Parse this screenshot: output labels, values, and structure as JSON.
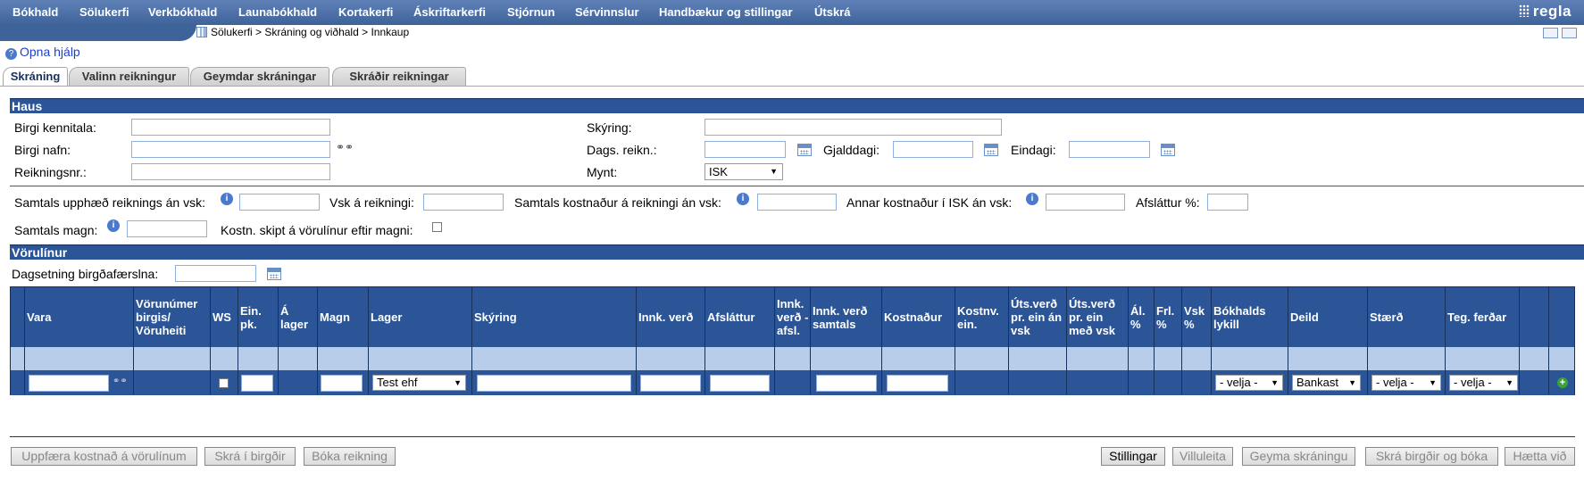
{
  "nav": {
    "items": [
      "Bókhald",
      "Sölukerfi",
      "Verkbókhald",
      "Launabókhald",
      "Kortakerfi",
      "Áskriftarkerfi",
      "Stjórnun",
      "Sérvinnslur",
      "Handbækur og stillingar",
      "Útskrá"
    ],
    "logo": "regla"
  },
  "breadcrumb": "Sölukerfi > Skráning og viðhald > Innkaup",
  "help": "Opna hjálp",
  "tabs": [
    "Skráning",
    "Valinn reikningur",
    "Geymdar skráningar",
    "Skráðir reikningar"
  ],
  "haus": {
    "title": "Haus",
    "birgi_kennitala": "Birgi kennitala:",
    "birgi_nafn": "Birgi nafn:",
    "reikningsnr": "Reikningsnr.:",
    "skyring": "Skýring:",
    "dags_reikn": "Dags. reikn.:",
    "gjalddagi": "Gjalddagi:",
    "eindagi": "Eindagi:",
    "mynt": "Mynt:",
    "mynt_value": "ISK"
  },
  "totals": {
    "samtals_upphaed": "Samtals upphæð reiknings án vsk:",
    "vsk": "Vsk á reikningi:",
    "samtals_kostnadur": "Samtals kostnaður á reikningi án vsk:",
    "annar_kostnadur": "Annar kostnaður í ISK án vsk:",
    "afslattur": "Afsláttur %:",
    "samtals_magn": "Samtals magn:",
    "kostn_skipt": "Kostn. skipt á vörulínur eftir magni:"
  },
  "vorulinur": {
    "title": "Vörulínur",
    "dagsetning": "Dagsetning birgðafærslna:",
    "headers": [
      "Vara",
      "Vörunúmer birgis/ Vöruheiti",
      "WS",
      "Ein. pk.",
      "Á lager",
      "Magn",
      "Lager",
      "Skýring",
      "Innk. verð",
      "Afsláttur",
      "Innk. verð - afsl.",
      "Innk. verð samtals",
      "Kostnaður",
      "Kostnv. ein.",
      "Úts.verð pr. ein án vsk",
      "Úts.verð pr. ein með vsk",
      "Ál. %",
      "Frl. %",
      "Vsk %",
      "Bókhalds lykill",
      "Deild",
      "Stærð",
      "Teg. ferðar"
    ],
    "lager_value": "Test ehf",
    "bokhalds_value": "- velja -",
    "deild_value": "Bankast",
    "staerd_value": "- velja -",
    "teg_value": "- velja -"
  },
  "buttons": {
    "uppfaera": "Uppfæra kostnað á vörulínum",
    "skra_birgdir": "Skrá í birgðir",
    "boka": "Bóka reikning",
    "stillingar": "Stillingar",
    "villuleita": "Villuleita",
    "geyma": "Geyma skráningu",
    "skra_boka": "Skrá birgðir og bóka",
    "haetta": "Hætta við"
  }
}
